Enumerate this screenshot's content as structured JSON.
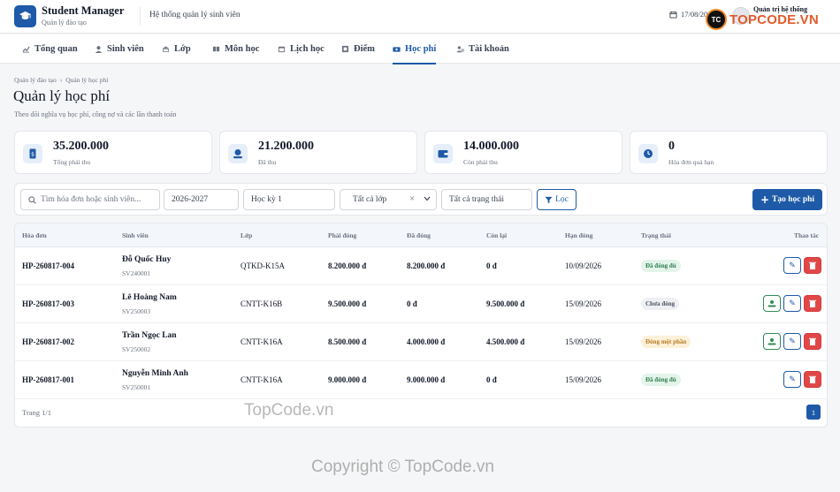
{
  "header": {
    "app_title": "Student Manager",
    "app_subtitle": "Quản lý đào tạo",
    "system_name": "Hệ thống quản lý sinh viên",
    "date": "17/08/20",
    "user_role": "Quản trị hệ thống",
    "watermark_logo": "TOPCODE.VN",
    "watermark_badge": "TC"
  },
  "nav": {
    "items": [
      {
        "label": "Tổng quan",
        "icon": "chart-line-icon"
      },
      {
        "label": "Sinh viên",
        "icon": "user-graduate-icon"
      },
      {
        "label": "Lớp",
        "icon": "school-icon"
      },
      {
        "label": "Môn học",
        "icon": "book-icon"
      },
      {
        "label": "Lịch học",
        "icon": "calendar-icon"
      },
      {
        "label": "Điểm",
        "icon": "grade-icon"
      },
      {
        "label": "Học phí",
        "icon": "money-bill-icon",
        "active": true
      },
      {
        "label": "Tài khoản",
        "icon": "user-cog-icon"
      }
    ]
  },
  "page": {
    "breadcrumb": [
      "Quản lý đào tạo",
      "Quản lý học phí"
    ],
    "title": "Quản lý học phí",
    "description": "Theo dõi nghĩa vụ học phí, công nợ và các lần thanh toán"
  },
  "stats": [
    {
      "value": "35.200.000",
      "label": "Tổng phải thu",
      "icon": "invoice-icon"
    },
    {
      "value": "21.200.000",
      "label": "Đã thu",
      "icon": "money-hand-icon"
    },
    {
      "value": "14.000.000",
      "label": "Còn phải thu",
      "icon": "wallet-icon"
    },
    {
      "value": "0",
      "label": "Hóa đơn quá hạn",
      "icon": "clock-icon"
    }
  ],
  "filters": {
    "search_placeholder": "Tìm hóa đơn hoặc sinh viên...",
    "year": "2026-2027",
    "semester": "Học kỳ 1",
    "class": "Tất cả lớp",
    "status": "Tất cả trạng thái",
    "filter_button": "Lọc",
    "create_button": "Tạo học phí"
  },
  "table": {
    "columns": [
      "Hóa đơn",
      "Sinh viên",
      "Lớp",
      "Phải đóng",
      "Đã đóng",
      "Còn lại",
      "Hạn đóng",
      "Trạng thái",
      "Thao tác"
    ],
    "rows": [
      {
        "invoice": "HP-260817-004",
        "student_name": "Đỗ Quốc Huy",
        "student_id": "SV240001",
        "class": "QTKD-K15A",
        "due": "8.200.000 đ",
        "paid": "8.200.000 đ",
        "remaining": "0 đ",
        "deadline": "10/09/2026",
        "status": "Đã đóng đủ",
        "status_kind": "paid"
      },
      {
        "invoice": "HP-260817-003",
        "student_name": "Lê Hoàng Nam",
        "student_id": "SV250003",
        "class": "CNTT-K16B",
        "due": "9.500.000 đ",
        "paid": "0 đ",
        "remaining": "9.500.000 đ",
        "deadline": "15/09/2026",
        "status": "Chưa đóng",
        "status_kind": "unpaid"
      },
      {
        "invoice": "HP-260817-002",
        "student_name": "Trần Ngọc Lan",
        "student_id": "SV250002",
        "class": "CNTT-K16A",
        "due": "8.500.000 đ",
        "paid": "4.000.000 đ",
        "remaining": "4.500.000 đ",
        "deadline": "15/09/2026",
        "status": "Đóng một phần",
        "status_kind": "partial"
      },
      {
        "invoice": "HP-260817-001",
        "student_name": "Nguyễn Minh Anh",
        "student_id": "SV250001",
        "class": "CNTT-K16A",
        "due": "9.000.000 đ",
        "paid": "9.000.000 đ",
        "remaining": "0 đ",
        "deadline": "15/09/2026",
        "status": "Đã đóng đủ",
        "status_kind": "paid"
      }
    ],
    "pagination_text": "Trang 1/1",
    "current_page": "1"
  },
  "watermarks": {
    "text1": "TopCode.vn",
    "text2": "Copyright © TopCode.vn"
  },
  "colors": {
    "primary": "#1e5aa8",
    "paid_bg": "#e3f4ea",
    "paid_fg": "#2e7d4f",
    "unpaid_bg": "#eef0f3",
    "unpaid_fg": "#4b5563",
    "partial_bg": "#fdf0d9",
    "partial_fg": "#b7791f"
  }
}
